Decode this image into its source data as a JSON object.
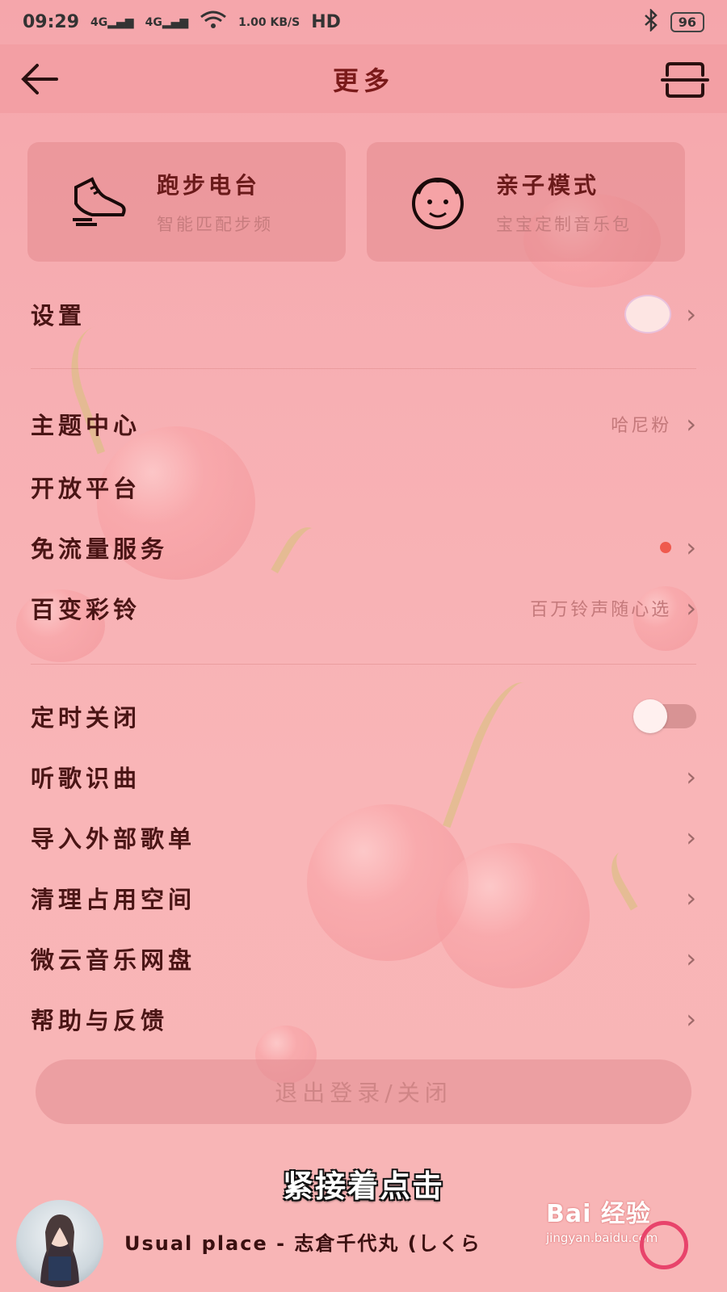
{
  "status_bar": {
    "time": "09:29",
    "net1": "4G",
    "net2": "4G",
    "speed": "1.00 KB/S",
    "hd": "HD",
    "battery": "96"
  },
  "header": {
    "title": "更多"
  },
  "cards": [
    {
      "title": "跑步电台",
      "subtitle": "智能匹配步频",
      "icon": "running-shoe-icon"
    },
    {
      "title": "亲子模式",
      "subtitle": "宝宝定制音乐包",
      "icon": "baby-face-icon"
    }
  ],
  "settings": {
    "label": "设置"
  },
  "group1": [
    {
      "label": "主题中心",
      "value": "哈尼粉"
    },
    {
      "label": "开放平台",
      "value": ""
    },
    {
      "label": "免流量服务",
      "value": ""
    },
    {
      "label": "百变彩铃",
      "value": "百万铃声随心选"
    }
  ],
  "group2": [
    {
      "label": "定时关闭",
      "toggle": false
    },
    {
      "label": "听歌识曲"
    },
    {
      "label": "导入外部歌单"
    },
    {
      "label": "清理占用空间"
    },
    {
      "label": "微云音乐网盘"
    },
    {
      "label": "帮助与反馈"
    }
  ],
  "logout": {
    "label": "退出登录/关闭"
  },
  "caption": "紧接着点击",
  "player": {
    "song": "Usual place - 志倉千代丸 (しくら"
  },
  "watermark": {
    "brand": "Bai 经验",
    "url": "jingyan.baidu.com"
  },
  "colors": {
    "accent": "#e8446b",
    "header_bg": "#f39fa4",
    "page_bg": "#f8b2b5"
  }
}
